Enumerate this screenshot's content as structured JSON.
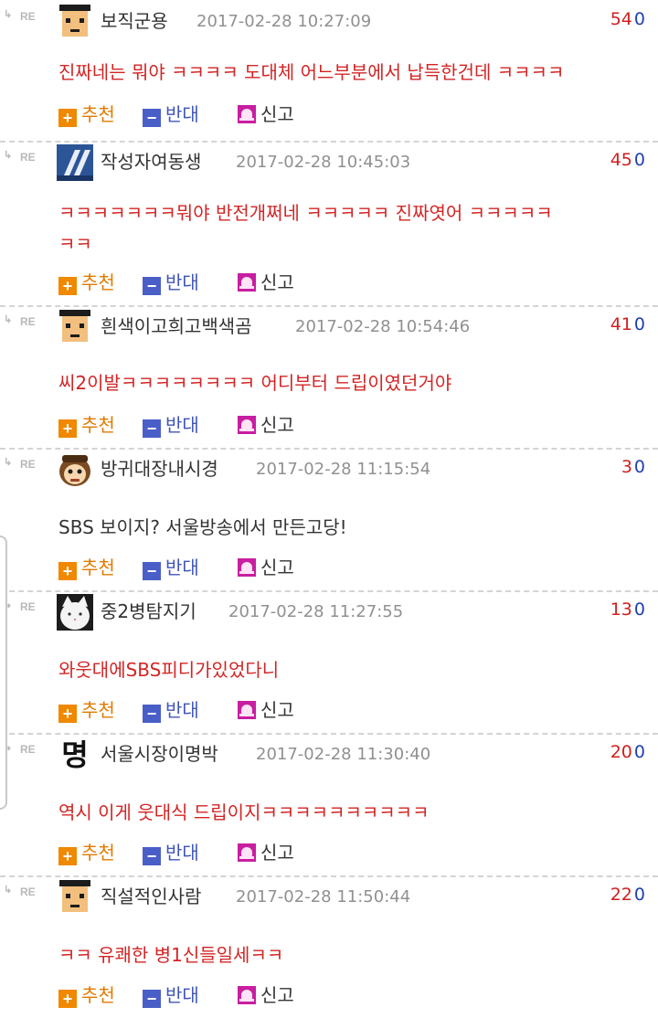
{
  "labels": {
    "re": "RE",
    "recommend": "추천",
    "oppose": "반대",
    "report": "신고",
    "plus": "+",
    "minus": "−"
  },
  "comments": [
    {
      "avatar": "pixel-face-cap-avatar",
      "nickname": "보직군용",
      "timestamp": "2017-02-28 10:27:09",
      "up": "54",
      "down": "0",
      "text_color": "#d32525",
      "lines": [
        "진짜네는 뭐야 ㅋㅋㅋㅋ 도대체 어느부분에서 납득한건데 ㅋㅋㅋㅋ"
      ]
    },
    {
      "avatar": "blue-tile-logo-avatar",
      "nickname": "작성자여동생",
      "timestamp": "2017-02-28 10:45:03",
      "up": "45",
      "down": "0",
      "text_color": "#d32525",
      "lines": [
        "ㅋㅋㅋㅋㅋㅋㅋ뭐야 반전개쩌네 ㅋㅋㅋㅋㅋ 진짜엿어 ㅋㅋㅋㅋㅋ",
        "ㅋㅋ"
      ]
    },
    {
      "avatar": "pixel-face-cap-avatar",
      "nickname": "흰색이고희고백색곰",
      "timestamp": "2017-02-28 10:54:46",
      "up": "41",
      "down": "0",
      "text_color": "#d32525",
      "lines": [
        "씨2이발ㅋㅋㅋㅋㅋㅋㅋㅋ 어디부터 드립이였던거야"
      ]
    },
    {
      "avatar": "cartoon-face-avatar",
      "nickname": "방귀대장내시경",
      "timestamp": "2017-02-28 11:15:54",
      "up": "3",
      "down": "0",
      "text_color": "#333333",
      "lines": [
        "SBS 보이지? 서울방송에서 만든고당!"
      ]
    },
    {
      "avatar": "white-cat-avatar",
      "nickname": "중2병탐지기",
      "timestamp": "2017-02-28 11:27:55",
      "up": "13",
      "down": "0",
      "text_color": "#d32525",
      "lines": [
        "와웃대에SBS피디가있었다니"
      ]
    },
    {
      "avatar": "myeong-glyph-avatar",
      "avatar_text": "명",
      "nickname": "서울시장이명박",
      "timestamp": "2017-02-28 11:30:40",
      "up": "20",
      "down": "0",
      "text_color": "#d32525",
      "lines": [
        "역시 이게 웃대식 드립이지ㅋㅋㅋㅋㅋㅋㅋㅋㅋㅋ"
      ]
    },
    {
      "avatar": "pixel-face-cap-avatar",
      "nickname": "직설적인사람",
      "timestamp": "2017-02-28 11:50:44",
      "up": "22",
      "down": "0",
      "text_color": "#d32525",
      "lines": [
        "ㅋㅋ 유쾌한 병1신들일세ㅋㅋ"
      ]
    }
  ]
}
